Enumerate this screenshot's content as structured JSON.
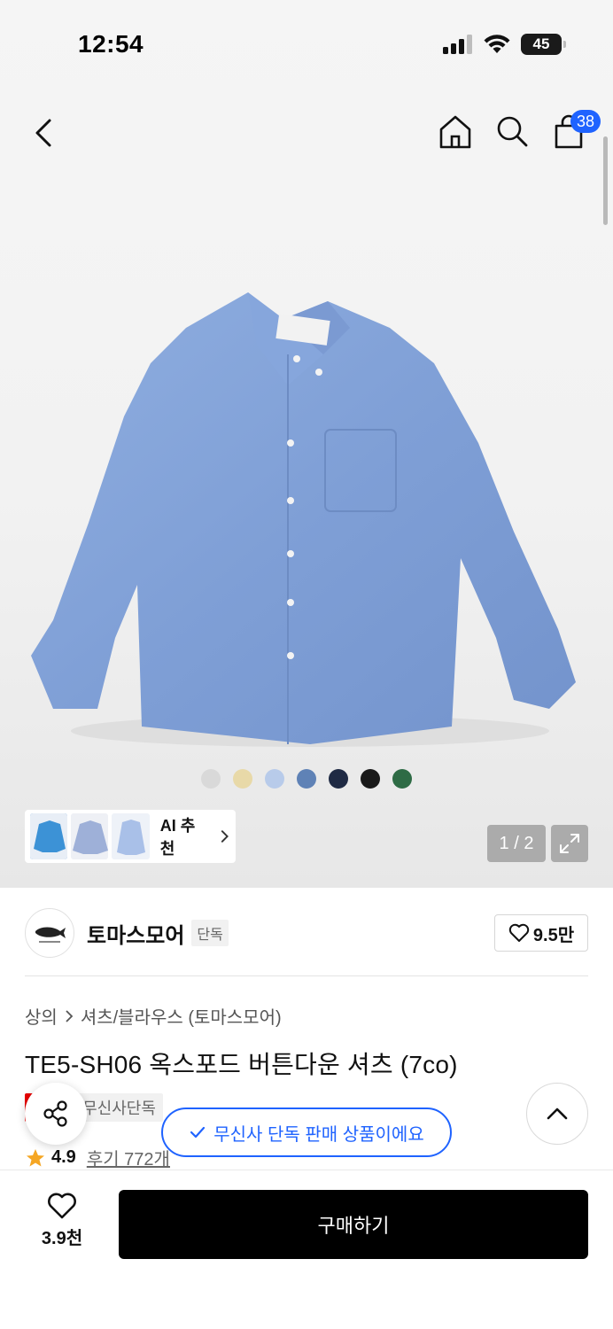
{
  "status_bar": {
    "time": "12:54",
    "battery": "45"
  },
  "header": {
    "cart_count": "38"
  },
  "gallery": {
    "page_indicator": "1 / 2",
    "color_options": [
      "#d9d9d9",
      "#e8d9a8",
      "#b8cbea",
      "#5f82b6",
      "#1f2a44",
      "#1a1a1a",
      "#2e6b45"
    ],
    "ai_recommend_label": "AI 추천"
  },
  "brand": {
    "name": "토마스모어",
    "tag": "단독",
    "likes": "9.5만"
  },
  "product": {
    "breadcrumb": [
      "상의",
      "셔츠/블라우스 (토마스모어)"
    ],
    "title": "TE5-SH06 옥스포드 버튼다운 셔츠 (7co)",
    "tags": [
      "세일",
      "무신사단독"
    ],
    "rating": "4.9",
    "reviews": "후기 772개"
  },
  "toast": {
    "message": "무신사 단독 판매 상품이에요"
  },
  "bottom_bar": {
    "wish_count": "3.9천",
    "buy_label": "구매하기"
  },
  "colors": {
    "accent_blue": "#1f63ff",
    "sale_red": "#e80000"
  }
}
